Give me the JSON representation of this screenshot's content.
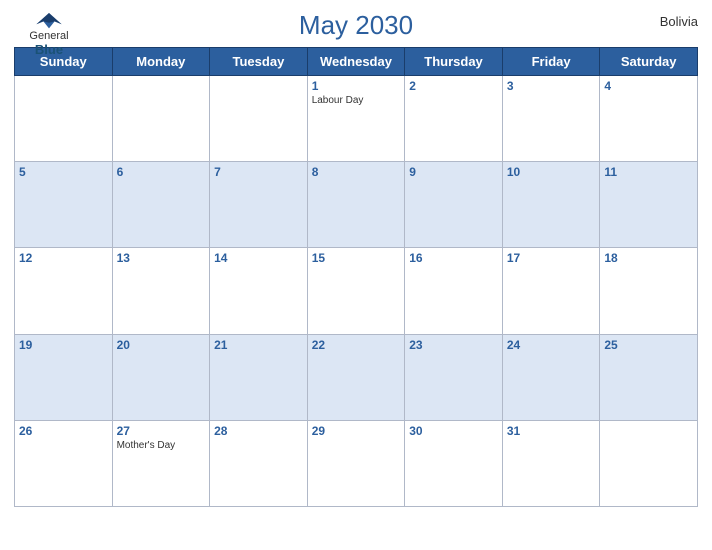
{
  "header": {
    "title": "May 2030",
    "country": "Bolivia",
    "logo": {
      "general": "General",
      "blue": "Blue"
    }
  },
  "days": [
    "Sunday",
    "Monday",
    "Tuesday",
    "Wednesday",
    "Thursday",
    "Friday",
    "Saturday"
  ],
  "weeks": [
    [
      {
        "date": "",
        "events": []
      },
      {
        "date": "",
        "events": []
      },
      {
        "date": "",
        "events": []
      },
      {
        "date": "1",
        "events": [
          "Labour Day"
        ]
      },
      {
        "date": "2",
        "events": []
      },
      {
        "date": "3",
        "events": []
      },
      {
        "date": "4",
        "events": []
      }
    ],
    [
      {
        "date": "5",
        "events": []
      },
      {
        "date": "6",
        "events": []
      },
      {
        "date": "7",
        "events": []
      },
      {
        "date": "8",
        "events": []
      },
      {
        "date": "9",
        "events": []
      },
      {
        "date": "10",
        "events": []
      },
      {
        "date": "11",
        "events": []
      }
    ],
    [
      {
        "date": "12",
        "events": []
      },
      {
        "date": "13",
        "events": []
      },
      {
        "date": "14",
        "events": []
      },
      {
        "date": "15",
        "events": []
      },
      {
        "date": "16",
        "events": []
      },
      {
        "date": "17",
        "events": []
      },
      {
        "date": "18",
        "events": []
      }
    ],
    [
      {
        "date": "19",
        "events": []
      },
      {
        "date": "20",
        "events": []
      },
      {
        "date": "21",
        "events": []
      },
      {
        "date": "22",
        "events": []
      },
      {
        "date": "23",
        "events": []
      },
      {
        "date": "24",
        "events": []
      },
      {
        "date": "25",
        "events": []
      }
    ],
    [
      {
        "date": "26",
        "events": []
      },
      {
        "date": "27",
        "events": [
          "Mother's Day"
        ]
      },
      {
        "date": "28",
        "events": []
      },
      {
        "date": "29",
        "events": []
      },
      {
        "date": "30",
        "events": []
      },
      {
        "date": "31",
        "events": []
      },
      {
        "date": "",
        "events": []
      }
    ]
  ],
  "colors": {
    "header_bg": "#2c5f9e",
    "row_odd": "#ffffff",
    "row_even": "#dce6f4",
    "date_color": "#2c5f9e",
    "border": "#b0b8c8"
  }
}
